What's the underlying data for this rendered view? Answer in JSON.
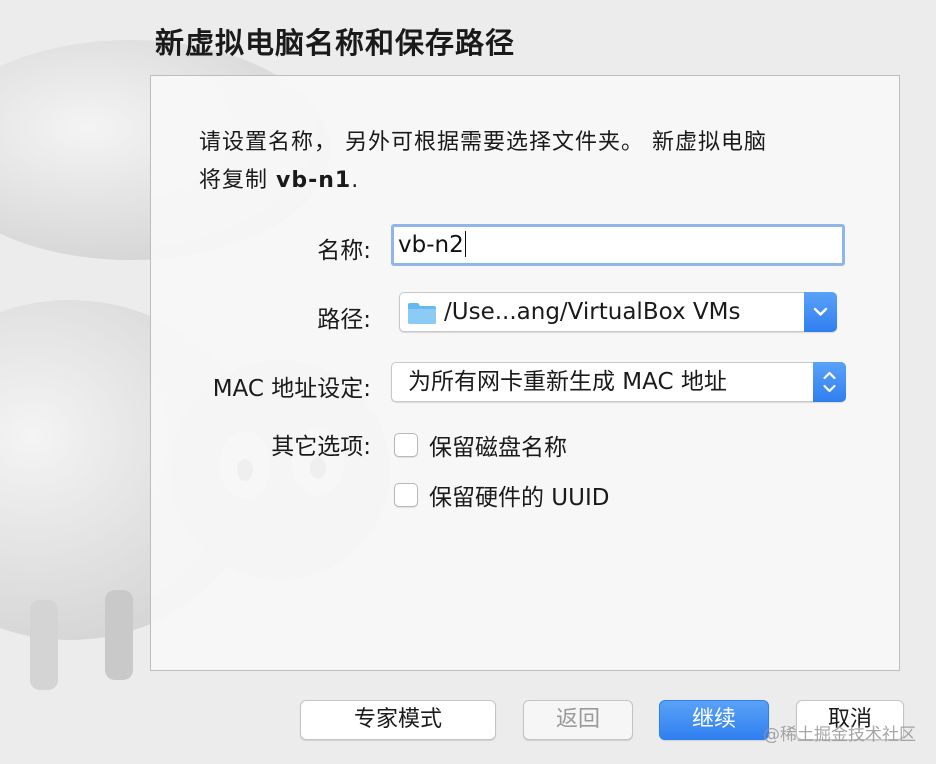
{
  "dialog": {
    "title": "新虚拟电脑名称和保存路径",
    "desc_line1": "请设置名称， 另外可根据需要选择文件夹。 新虚拟电脑",
    "desc_line2_prefix": "将复制 ",
    "desc_source_vm": "vb-n1",
    "desc_line2_suffix": "."
  },
  "form": {
    "name_label": "名称:",
    "name_value": "vb-n2",
    "path_label": "路径:",
    "path_value": "/Use...ang/VirtualBox VMs",
    "mac_label": "MAC 地址设定:",
    "mac_value": "为所有网卡重新生成 MAC 地址",
    "other_label": "其它选项:",
    "option_keep_disk_names": "保留磁盘名称",
    "option_keep_hardware_uuid": "保留硬件的 UUID",
    "keep_disk_names_checked": false,
    "keep_hardware_uuid_checked": false
  },
  "buttons": {
    "expert": "专家模式",
    "back": "返回",
    "continue": "继续",
    "cancel": "取消"
  },
  "watermark": "@稀土掘金技术社区",
  "icons": {
    "path_folder": "folder-icon",
    "path_dropdown": "chevron-down-icon",
    "mac_stepper": "up-down-chevron-icon"
  },
  "colors": {
    "accent": "#2f7ff0",
    "focus_ring": "#8fb5ea",
    "folder": "#66b8f0"
  }
}
